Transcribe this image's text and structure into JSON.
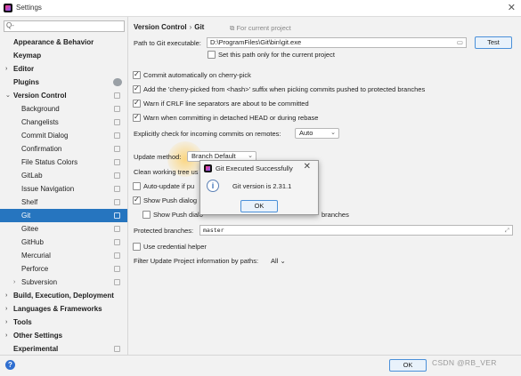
{
  "window": {
    "title": "Settings"
  },
  "sidebar": {
    "search_placeholder": "Q-",
    "items": [
      {
        "label": "Appearance & Behavior",
        "indent": 0,
        "arrow": "none",
        "bold": true
      },
      {
        "label": "Keymap",
        "indent": 0,
        "arrow": "none",
        "bold": true
      },
      {
        "label": "Editor",
        "indent": 0,
        "arrow": "right",
        "bold": true
      },
      {
        "label": "Plugins",
        "indent": 0,
        "arrow": "none",
        "bold": true,
        "badge": true
      },
      {
        "label": "Version Control",
        "indent": 0,
        "arrow": "down",
        "bold": true,
        "cfg": true
      },
      {
        "label": "Background",
        "indent": 1,
        "arrow": "none",
        "cfg": true
      },
      {
        "label": "Changelists",
        "indent": 1,
        "arrow": "none",
        "cfg": true
      },
      {
        "label": "Commit Dialog",
        "indent": 1,
        "arrow": "none",
        "cfg": true
      },
      {
        "label": "Confirmation",
        "indent": 1,
        "arrow": "none",
        "cfg": true
      },
      {
        "label": "File Status Colors",
        "indent": 1,
        "arrow": "none",
        "cfg": true
      },
      {
        "label": "GitLab",
        "indent": 1,
        "arrow": "none",
        "cfg": true
      },
      {
        "label": "Issue Navigation",
        "indent": 1,
        "arrow": "none",
        "cfg": true
      },
      {
        "label": "Shelf",
        "indent": 1,
        "arrow": "none",
        "cfg": true
      },
      {
        "label": "Git",
        "indent": 1,
        "arrow": "none",
        "cfg": true,
        "selected": true
      },
      {
        "label": "Gitee",
        "indent": 1,
        "arrow": "none",
        "cfg": true
      },
      {
        "label": "GitHub",
        "indent": 1,
        "arrow": "none",
        "cfg": true
      },
      {
        "label": "Mercurial",
        "indent": 1,
        "arrow": "none",
        "cfg": true
      },
      {
        "label": "Perforce",
        "indent": 1,
        "arrow": "none",
        "cfg": true
      },
      {
        "label": "Subversion",
        "indent": 1,
        "arrow": "right",
        "cfg": true
      },
      {
        "label": "Build, Execution, Deployment",
        "indent": 0,
        "arrow": "right",
        "bold": true
      },
      {
        "label": "Languages & Frameworks",
        "indent": 0,
        "arrow": "right",
        "bold": true
      },
      {
        "label": "Tools",
        "indent": 0,
        "arrow": "right",
        "bold": true
      },
      {
        "label": "Other Settings",
        "indent": 0,
        "arrow": "right",
        "bold": true
      },
      {
        "label": "Experimental",
        "indent": 0,
        "arrow": "none",
        "bold": true,
        "cfg": true
      }
    ]
  },
  "main": {
    "breadcrumb": [
      "Version Control",
      "Git"
    ],
    "project_note": "For current project",
    "git_path": {
      "label": "Path to Git executable:",
      "value": "D:\\ProgramFiles\\Git\\bin\\git.exe",
      "test_label": "Test",
      "current_project_only": "Set this path only for the current project"
    },
    "options": [
      {
        "label": "Commit automatically on cherry-pick",
        "checked": true
      },
      {
        "label": "Add the 'cherry-picked from <hash>' suffix when picking commits pushed to protected branches",
        "checked": true
      },
      {
        "label": "Warn if CRLF line separators are about to be committed",
        "checked": true
      },
      {
        "label": "Warn when committing in detached HEAD or during rebase",
        "checked": true
      }
    ],
    "incoming": {
      "label": "Explicitly check for incoming commits on remotes:",
      "value": "Auto"
    },
    "update_method": {
      "label": "Update method:",
      "value": "Branch Default"
    },
    "clean_tree": {
      "label": "Clean working tree us"
    },
    "auto_update": {
      "label": "Auto-update if pu",
      "checked": false
    },
    "show_push": {
      "label": "Show Push dialog",
      "checked": true
    },
    "show_push_protected": {
      "label": "Show Push dialo",
      "suffix": "branches",
      "checked": false
    },
    "protected_branches": {
      "label": "Protected branches:",
      "value": "master"
    },
    "credential_helper": {
      "label": "Use credential helper",
      "checked": false
    },
    "filter_update": {
      "label": "Filter Update Project information by paths:",
      "value": "All"
    }
  },
  "dialog": {
    "title": "Git Executed Successfully",
    "message": "Git version is 2.31.1",
    "ok_label": "OK"
  },
  "footer": {
    "help": "?",
    "ok_label": "OK",
    "watermark": "CSDN @RB_VER"
  }
}
